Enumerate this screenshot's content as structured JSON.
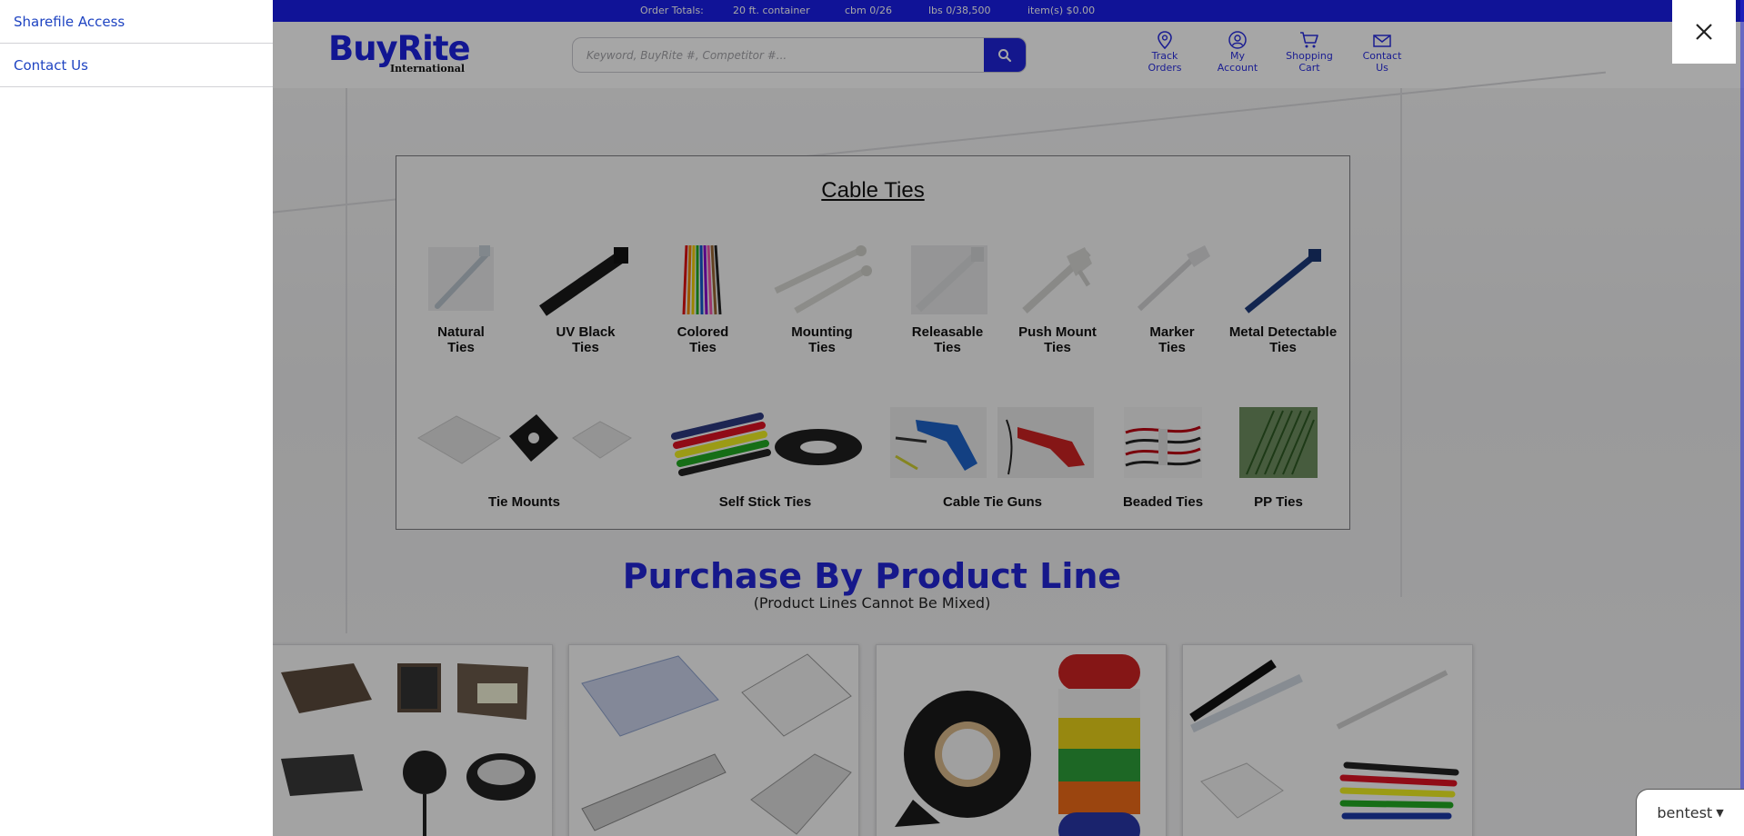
{
  "topbar": {
    "order_totals": "Order Totals:",
    "container": "20 ft. container",
    "cbm": "cbm 0/26",
    "lbs": "lbs 0/38,500",
    "items": "item(s) $0.00"
  },
  "header": {
    "logo_text": "BuyRite",
    "logo_sub": "International",
    "search": {
      "placeholder": "Keyword, BuyRite #, Competitor #..."
    },
    "links": {
      "track": [
        "Track",
        "Orders"
      ],
      "account": [
        "My",
        "Account"
      ],
      "cart": [
        "Shopping",
        "Cart"
      ],
      "contact": [
        "Contact",
        "Us"
      ]
    }
  },
  "sidebar": {
    "items": [
      {
        "label": "Sharefile Access"
      },
      {
        "label": "Contact Us"
      }
    ]
  },
  "cable_ties": {
    "title": "Cable Ties",
    "row1": [
      {
        "label1": "Natural",
        "label2": "Ties"
      },
      {
        "label1": "UV Black",
        "label2": "Ties"
      },
      {
        "label1": "Colored",
        "label2": "Ties"
      },
      {
        "label1": "Mounting",
        "label2": "Ties"
      },
      {
        "label1": "Releasable",
        "label2": "Ties"
      },
      {
        "label1": "Push Mount",
        "label2": "Ties"
      },
      {
        "label1": "Marker",
        "label2": "Ties"
      },
      {
        "label1": "Metal Detectable",
        "label2": "Ties"
      }
    ],
    "row2": [
      {
        "label": "Tie Mounts"
      },
      {
        "label": "Self Stick Ties"
      },
      {
        "label": "Cable Tie Guns"
      },
      {
        "label": "Beaded Ties"
      },
      {
        "label": "PP Ties"
      }
    ]
  },
  "purchase": {
    "title": "Purchase By Product Line",
    "subtitle": "(Product Lines Cannot Be Mixed)"
  },
  "chat": {
    "label": "bentest"
  },
  "colors": {
    "brand_blue": "#1a1ee8",
    "link_blue": "#1f44c2",
    "title_blue": "#2326d6"
  },
  "icons": {
    "close": "close-icon",
    "search": "search-icon",
    "track": "map-pin-icon",
    "account": "user-icon",
    "cart": "cart-icon",
    "contact": "envelope-icon"
  }
}
